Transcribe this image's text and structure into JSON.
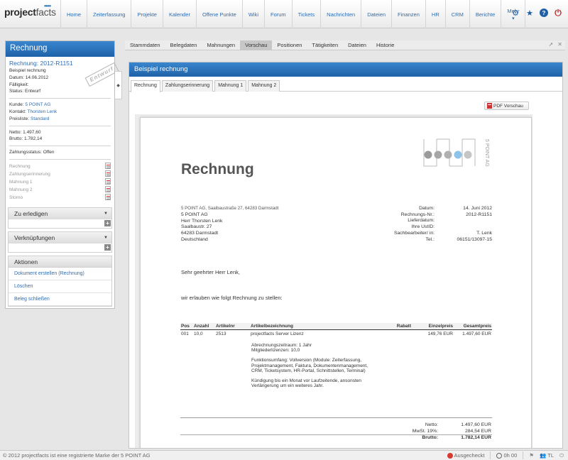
{
  "app": {
    "logo_bold": "project",
    "logo_light": "facts",
    "logo_dots": "•••••"
  },
  "nav": {
    "items": [
      "Home",
      "Zeiterfassung",
      "Projekte",
      "Kalender",
      "Offene Punkte",
      "Wiki",
      "Forum",
      "Tickets",
      "Nachrichten",
      "Dateien",
      "Finanzen",
      "HR",
      "CRM",
      "Berichte"
    ],
    "more": "Mehr"
  },
  "left": {
    "title": "Rechnung",
    "doc_number": "Rechnung: 2012-R1151",
    "doc_name": "Beispiel rechnung",
    "date_line": "Datum: 14.06.2012",
    "due_line": "Fälligkeit:",
    "status_line": "Status: Entwurf",
    "stamp": "Entwurf",
    "customer_label": "Kunde: ",
    "customer_value": "5 POINT AG",
    "contact_label": "Kontakt: ",
    "contact_value": "Thorsten Lenk",
    "pricelist_label": "Preisliste: ",
    "pricelist_value": "Standard",
    "net_line": "Netto: 1.497,60",
    "gross_line": "Brutto: 1.782,14",
    "payment_line": "Zahlungsstatus: Offen",
    "documents": [
      "Rechnung",
      "Zahlungserinnerung",
      "Mahnung 1",
      "Mahnung 2",
      "Storno"
    ],
    "todo_title": "Zu erledigen",
    "links_title": "Verknüpfungen",
    "actions_title": "Aktionen",
    "actions": [
      "Dokument erstellen (Rechnung)",
      "Löschen",
      "Beleg schließen"
    ]
  },
  "tabs": [
    "Stammdaten",
    "Belegdaten",
    "Mahnungen",
    "Vorschau",
    "Positionen",
    "Tätigkeiten",
    "Dateien",
    "Historie"
  ],
  "active_tab": "Vorschau",
  "content": {
    "title": "Beispiel rechnung",
    "subtabs": [
      "Rechnung",
      "Zahlungserinnerung",
      "Mahnung 1",
      "Mahnung 2"
    ],
    "pdf_button": "PDF Vorschau"
  },
  "invoice": {
    "heading": "Rechnung",
    "brand_text": "5 POINT AG",
    "sender_line": "5 POINT AG, Saalbaustraße 27, 64283 Darmstadt",
    "address": [
      "5 POINT AG",
      "Herr Thorsten Lenk",
      "Saalbaustr. 27",
      "64283 Darmstadt",
      "Deutschland"
    ],
    "meta": [
      {
        "k": "Datum:",
        "v": "14. Juni 2012"
      },
      {
        "k": "Rechnungs-Nr.:",
        "v": "2012-R1151"
      },
      {
        "k": "Lieferdatum:",
        "v": ""
      },
      {
        "k": "Ihre UstID:",
        "v": ""
      },
      {
        "k": "Sachbearbeiter/ in:",
        "v": "T. Lenk"
      },
      {
        "k": "Tel.:",
        "v": "06151/13097-15"
      }
    ],
    "greeting": "Sehr geehrter Herr Lenk,",
    "intro": "wir erlauben wie folgt Rechnung zu stellen:",
    "columns": [
      "Pos",
      "Anzahl",
      "Artikelnr",
      "Artikelbezeichnung",
      "Rabatt",
      "Einzelpreis",
      "Gesamtpreis"
    ],
    "row": {
      "pos": "001",
      "anz": "10,0",
      "art": "2513",
      "bez": "projectfacts Server Lizenz",
      "rab": "",
      "ep": "149,76 EUR",
      "gp": "1.497,60 EUR"
    },
    "description": [
      "Abrechnungszeitraum: 1 Jahr\nMitgliederlizenzen: 10,0",
      "Funktionsumfang: Vollversion (Module: Zeiterfassung,\nProjektmanagement, Faktura, Dokumentenmanagement,\nCRM, Ticketsystem, HR-Portal, Schnittstellen, Terminal)",
      "Kündigung bis ein Monat vor Laufzeitende, ansonsten\nVerlängerung um ein weiteres Jahr."
    ],
    "totals": [
      {
        "k": "Netto:",
        "v": "1.497,60 EUR"
      },
      {
        "k": "MwSt. 19%:",
        "v": "284,54 EUR"
      },
      {
        "k": "Brutto:",
        "v": "1.782,14 EUR"
      }
    ]
  },
  "footer": {
    "copyright": "© 2012 projectfacts ist eine registrierte Marke der 5 POINT AG",
    "status": "Ausgecheckt",
    "time": "0h 00",
    "user": "TL"
  }
}
